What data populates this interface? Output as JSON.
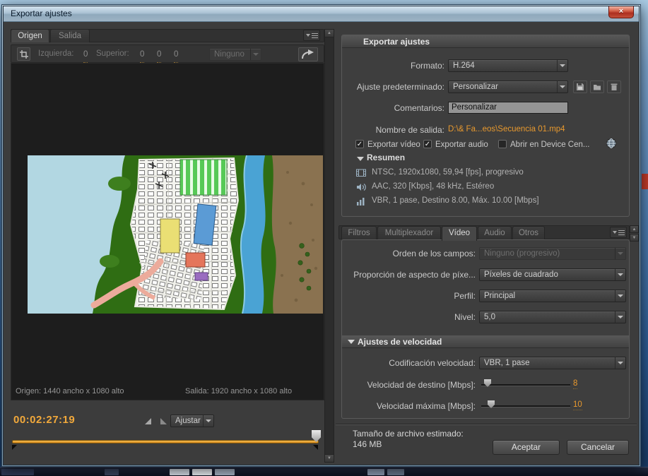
{
  "colors": {
    "accent_orange": "#e8992e",
    "dialog_bg": "#3c3c3c",
    "group_border": "#5a5a5a"
  },
  "icons": {
    "close": "×",
    "check": "✓"
  },
  "window": {
    "title": "Exportar ajustes"
  },
  "source_panel": {
    "tabs": [
      {
        "label": "Origen"
      },
      {
        "label": "Salida"
      }
    ],
    "toolbar": {
      "left_label": "Izquierda:",
      "left_value": "0",
      "top_label": "Superior:",
      "top_value": "0",
      "right_value": "0",
      "bottom_value": "0",
      "crop_mode_value": "Ninguno"
    },
    "status_source": "Origen: 1440 ancho x 1080 alto",
    "status_output": "Salida: 1920 ancho x 1080 alto",
    "timecode": "00:02:27:19",
    "fit_value": "Ajustar"
  },
  "settings": {
    "header": "Exportar ajustes",
    "format_label": "Formato:",
    "format_value": "H.264",
    "preset_label": "Ajuste predeterminado:",
    "preset_value": "Personalizar",
    "comments_label": "Comentarios:",
    "comments_value": "Personalizar",
    "output_label": "Nombre de salida:",
    "output_value": "D:\\& Fa...eos\\Secuencia 01.mp4",
    "export_video": "Exportar vídeo",
    "export_audio": "Exportar audio",
    "device_central": "Abrir en Device Cen...",
    "summary_header": "Resumen",
    "summary_video": "NTSC, 1920x1080, 59,94 [fps], progresivo",
    "summary_audio": "AAC, 320 [Kbps], 48 kHz, Estéreo",
    "summary_bitrate": "VBR, 1 pase, Destino 8.00, Máx. 10.00 [Mbps]"
  },
  "options": {
    "tabs": [
      "Filtros",
      "Multiplexador",
      "Vídeo",
      "Audio",
      "Otros"
    ],
    "active_tab": "Vídeo",
    "field_order_label": "Orden de los campos:",
    "field_order_value": "Ninguno (progresivo)",
    "pixel_aspect_label": "Proporción de aspecto de píxe...",
    "pixel_aspect_value": "Píxeles de cuadrado",
    "profile_label": "Perfil:",
    "profile_value": "Principal",
    "level_label": "Nivel:",
    "level_value": "5,0",
    "bitrate_header": "Ajustes de velocidad",
    "encoding_label": "Codificación velocidad:",
    "encoding_value": "VBR, 1 pase",
    "target_bitrate_label": "Velocidad de destino [Mbps]:",
    "target_bitrate_value": "8",
    "max_bitrate_label": "Velocidad máxima [Mbps]:",
    "max_bitrate_value": "10"
  },
  "footer": {
    "estimated_size_label": "Tamaño de archivo estimado:",
    "estimated_size_value": "146 MB",
    "ok_label": "Aceptar",
    "cancel_label": "Cancelar"
  }
}
